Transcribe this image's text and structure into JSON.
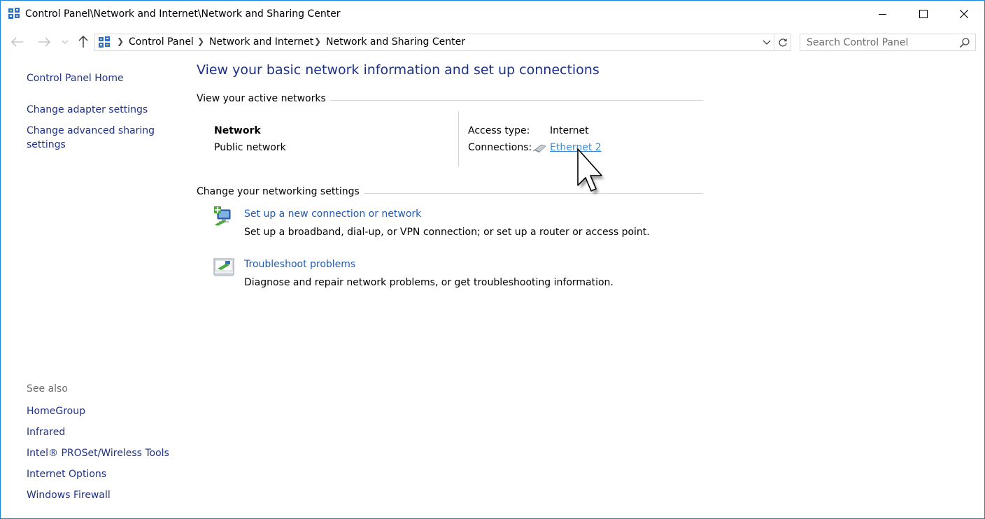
{
  "window": {
    "title": "Control Panel\\Network and Internet\\Network and Sharing Center"
  },
  "address": {
    "crumbs": [
      "Control Panel",
      "Network and Internet",
      "Network and Sharing Center"
    ]
  },
  "search": {
    "placeholder": "Search Control Panel"
  },
  "sidebar": {
    "links": [
      "Control Panel Home",
      "Change adapter settings",
      "Change advanced sharing settings"
    ],
    "see_also_title": "See also",
    "see_also": [
      "HomeGroup",
      "Infrared",
      "Intel® PROSet/Wireless Tools",
      "Internet Options",
      "Windows Firewall"
    ]
  },
  "main": {
    "title": "View your basic network information and set up connections",
    "active_networks": {
      "heading": "View your active networks",
      "network_name": "Network",
      "network_type": "Public network",
      "access_type_label": "Access type:",
      "access_type_value": "Internet",
      "connections_label": "Connections:",
      "connection_link": "Ethernet 2"
    },
    "settings": {
      "heading": "Change your networking settings",
      "tasks": [
        {
          "title": "Set up a new connection or network",
          "description": "Set up a broadband, dial-up, or VPN connection; or set up a router or access point.",
          "icon": "new-connection-icon"
        },
        {
          "title": "Troubleshoot problems",
          "description": "Diagnose and repair network problems, or get troubleshooting information.",
          "icon": "troubleshoot-icon"
        }
      ]
    }
  },
  "colors": {
    "heading_blue": "#1e3287",
    "link_blue": "#1e5ab4",
    "hover_link": "#3a8ad6",
    "window_border": "#1883d7"
  }
}
